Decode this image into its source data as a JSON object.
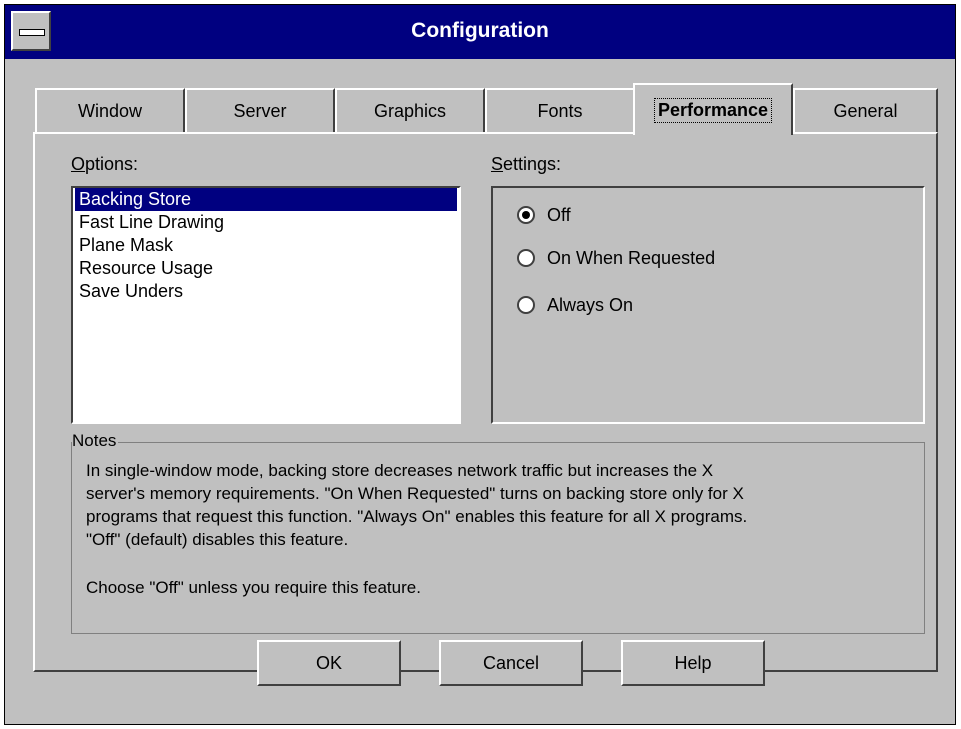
{
  "window": {
    "title": "Configuration"
  },
  "tabs": [
    {
      "label": "Window"
    },
    {
      "label": "Server"
    },
    {
      "label": "Graphics"
    },
    {
      "label": "Fonts"
    },
    {
      "label": "Performance",
      "active": true
    },
    {
      "label": "General"
    }
  ],
  "options": {
    "label_prefix": "",
    "label_mnemonic": "O",
    "label_rest": "ptions:",
    "items": [
      "Backing Store",
      "Fast Line Drawing",
      "Plane Mask",
      "Resource Usage",
      "Save Unders"
    ],
    "selected_index": 0
  },
  "settings": {
    "label_mnemonic": "S",
    "label_rest": "ettings:",
    "radios": [
      {
        "label": "Off",
        "checked": true
      },
      {
        "label": "On When Requested",
        "checked": false
      },
      {
        "label": "Always On",
        "checked": false
      }
    ]
  },
  "notes": {
    "legend": "Notes",
    "lines": [
      "In single-window mode, backing store decreases network traffic but increases the X",
      "server's memory requirements. \"On When Requested\" turns on backing store only for X",
      "programs that request this function. \"Always On\" enables this feature for all X programs.",
      "\"Off\" (default) disables this feature.",
      "Choose \"Off\" unless you require this feature."
    ]
  },
  "buttons": {
    "ok": "OK",
    "cancel": "Cancel",
    "help": "Help"
  },
  "colors": {
    "face": "#c0c0c0",
    "titlebar": "#000080",
    "selection": "#000080"
  }
}
